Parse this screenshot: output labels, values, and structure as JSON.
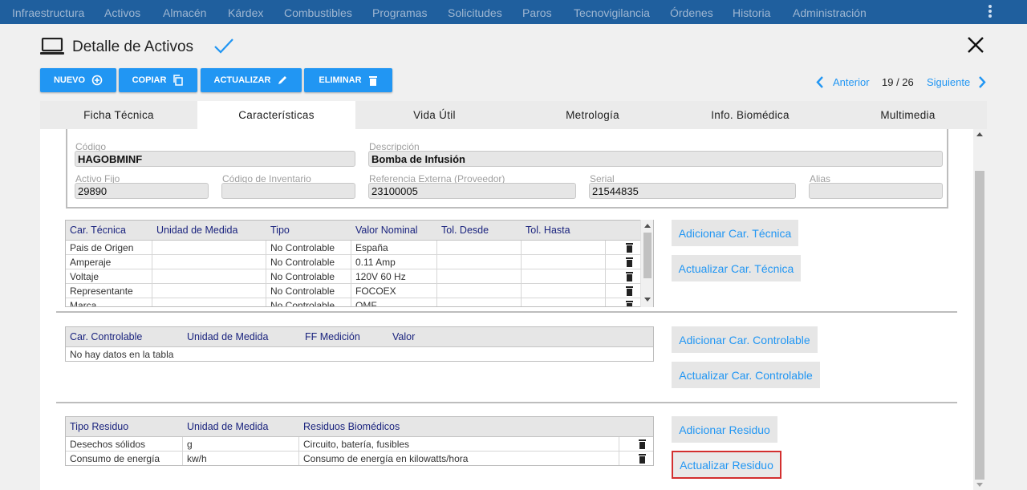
{
  "nav": {
    "items": [
      "Infraestructura",
      "Activos",
      "Almacén",
      "Kárdex",
      "Combustibles",
      "Programas",
      "Solicitudes",
      "Paros",
      "Tecnovigilancia",
      "Órdenes",
      "Historia",
      "Administración"
    ]
  },
  "header": {
    "title": "Detalle de Activos",
    "icon": "laptop-icon"
  },
  "toolbar": {
    "nuevo": "NUEVO",
    "copiar": "COPIAR",
    "actualizar": "ACTUALIZAR",
    "eliminar": "ELIMINAR"
  },
  "pager": {
    "prev": "Anterior",
    "position": "19 / 26",
    "next": "Siguiente"
  },
  "tabs": [
    "Ficha Técnica",
    "Características",
    "Vida Útil",
    "Metrología",
    "Info. Biomédica",
    "Multimedia"
  ],
  "active_tab": "Características",
  "fields": {
    "codigo_label": "Código",
    "codigo": "HAGOBMINF",
    "descripcion_label": "Descripción",
    "descripcion": "Bomba de Infusión",
    "activo_fijo_label": "Activo Fijo",
    "activo_fijo": "29890",
    "codigo_inventario_label": "Código de Inventario",
    "codigo_inventario": "",
    "referencia_label": "Referencia Externa (Proveedor)",
    "referencia": "23100005",
    "serial_label": "Serial",
    "serial": "21544835",
    "alias_label": "Alias",
    "alias": ""
  },
  "tecnica": {
    "headers": [
      "Car. Técnica",
      "Unidad de Medida",
      "Tipo",
      "Valor Nominal",
      "Tol. Desde",
      "Tol. Hasta"
    ],
    "rows": [
      [
        "Pais de Origen",
        "",
        "No Controlable",
        "España",
        "",
        ""
      ],
      [
        "Amperaje",
        "",
        "No Controlable",
        "0.11 Amp",
        "",
        ""
      ],
      [
        "Voltaje",
        "",
        "No Controlable",
        "120V 60 Hz",
        "",
        ""
      ],
      [
        "Representante",
        "",
        "No Controlable",
        "FOCOEX",
        "",
        ""
      ],
      [
        "Marca",
        "",
        "No Controlable",
        "OMF",
        "",
        ""
      ]
    ],
    "add_button": "Adicionar Car. Técnica",
    "update_button": "Actualizar Car. Técnica"
  },
  "controlable": {
    "headers": [
      "Car. Controlable",
      "Unidad de Medida",
      "FF Medición",
      "Valor"
    ],
    "empty": "No hay datos en la tabla",
    "add_button": "Adicionar Car. Controlable",
    "update_button": "Actualizar Car. Controlable"
  },
  "residuo": {
    "headers": [
      "Tipo Residuo",
      "Unidad de Medida",
      "Residuos Biomédicos"
    ],
    "rows": [
      [
        "Desechos sólidos",
        "g",
        "Circuito, batería, fusibles"
      ],
      [
        "Consumo de energía",
        "kw/h",
        "Consumo de energía en kilowatts/hora"
      ]
    ],
    "add_button": "Adicionar Residuo",
    "update_button": "Actualizar Residuo"
  },
  "colors": {
    "nav_bg": "#1f5f9e",
    "primary": "#2196f3",
    "header_text": "#1a237e",
    "highlight": "#d32f2f"
  }
}
